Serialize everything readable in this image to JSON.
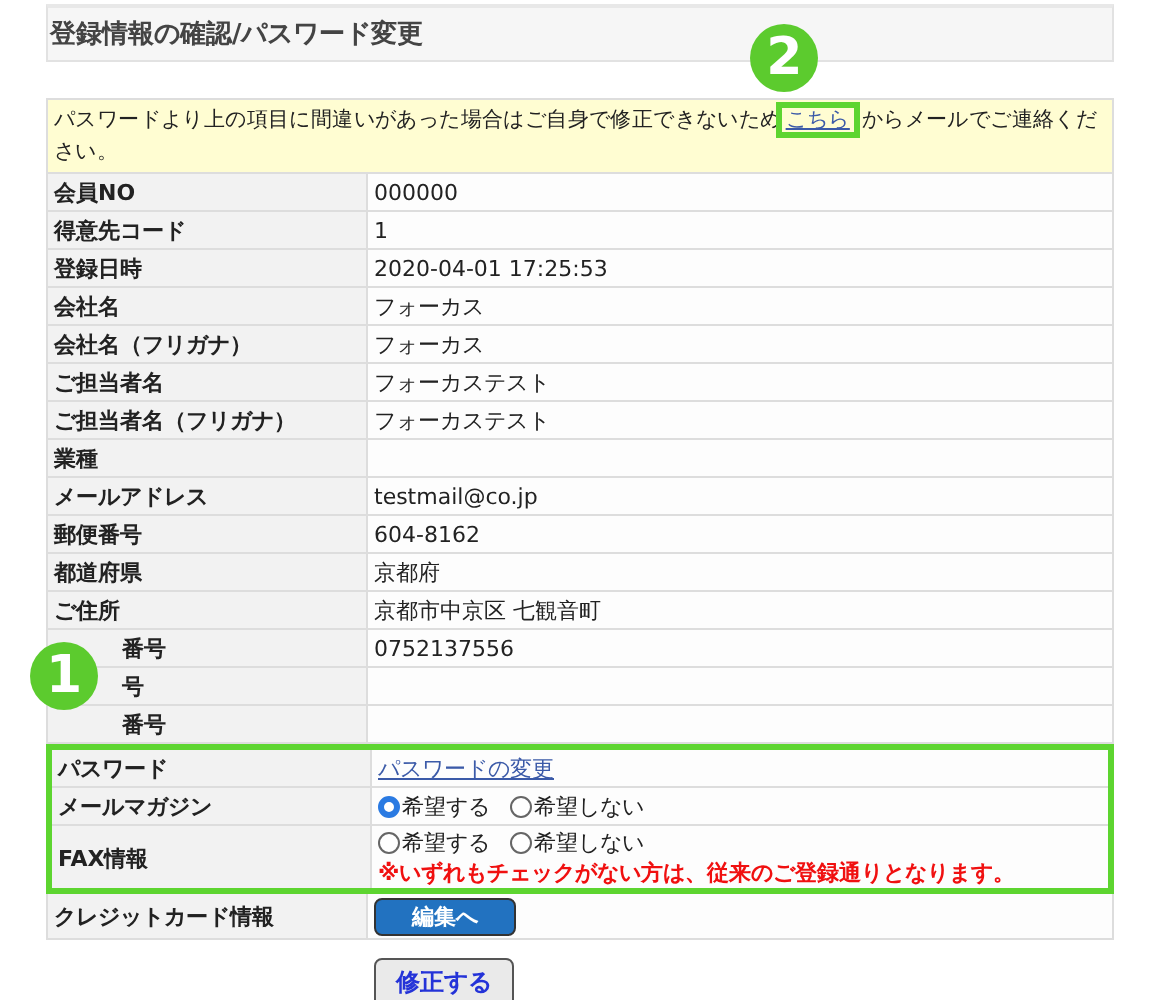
{
  "page_title": "登録情報の確認/パスワード変更",
  "notice": {
    "before": "パスワードより上の項目に間違いがあった場合はご自身で修正できないため",
    "link": "こちら",
    "link_highlighted": true,
    "badge": "2",
    "after": "からメールでご連絡ください。"
  },
  "sections": [
    {
      "kind": "plain",
      "rows": [
        {
          "label": "会員NO",
          "kind": "text",
          "value": "000000"
        },
        {
          "label": "得意先コード",
          "kind": "text",
          "value": "1"
        },
        {
          "label": "登録日時",
          "kind": "text",
          "value": "2020-04-01 17:25:53"
        },
        {
          "label": "会社名",
          "kind": "text",
          "value": "フォーカス"
        },
        {
          "label": "会社名（フリガナ）",
          "kind": "text",
          "value": "フォーカス"
        },
        {
          "label": "ご担当者名",
          "kind": "text",
          "value": "フォーカステスト"
        },
        {
          "label": "ご担当者名（フリガナ）",
          "kind": "text",
          "value": "フォーカステスト"
        },
        {
          "label": "業種",
          "kind": "text"
        },
        {
          "label": "メールアドレス",
          "kind": "text",
          "value": "testmail@co.jp"
        },
        {
          "label": "郵便番号",
          "kind": "text",
          "value": "604-8162"
        },
        {
          "label": "都道府県",
          "kind": "text",
          "value": "京都府"
        },
        {
          "label": "ご住所",
          "kind": "text",
          "value": "京都市中京区 七観音町"
        },
        {
          "label": "番号",
          "kind": "text",
          "value": "0752137556",
          "partly_covered": true
        },
        {
          "label": "号",
          "kind": "text",
          "partly_covered": true
        },
        {
          "label": "番号",
          "kind": "text",
          "partly_covered": true
        }
      ]
    },
    {
      "kind": "highlight",
      "badge": "1",
      "rows": [
        {
          "label": "パスワード",
          "kind": "link",
          "value": "パスワードの変更"
        },
        {
          "label": "メールマガジン",
          "kind": "radio",
          "options": [
            {
              "label": "希望する",
              "selected": true
            },
            {
              "label": "希望しない",
              "selected": false
            }
          ]
        },
        {
          "label": "FAX情報",
          "kind": "radio",
          "options": [
            {
              "label": "希望する",
              "selected": false
            },
            {
              "label": "希望しない",
              "selected": false
            }
          ],
          "note": "※いずれもチェックがない方は、従来のご登録通りとなります。"
        }
      ]
    },
    {
      "kind": "plain",
      "rows": [
        {
          "label": "クレジットカード情報",
          "kind": "button",
          "value": "編集へ"
        }
      ]
    }
  ],
  "submit": "修正する"
}
